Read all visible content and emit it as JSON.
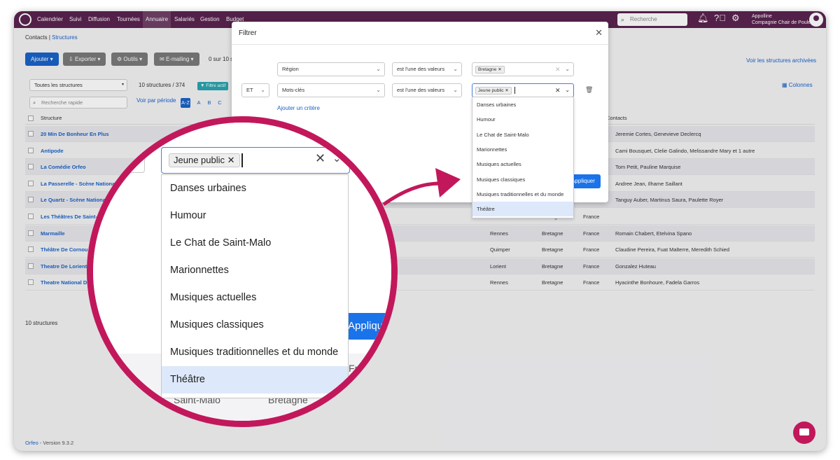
{
  "nav": {
    "items": [
      "Calendrier",
      "Suivi",
      "Diffusion",
      "Tournées",
      "Annuaire",
      "Salariés",
      "Gestion",
      "Budget"
    ],
    "active": "Annuaire",
    "search_placeholder": "Recherche",
    "user_name": "Appolline",
    "user_company": "Compagnie Chair de Poule"
  },
  "breadcrumb": {
    "root": "Contacts",
    "sep": "|",
    "current": "Structures"
  },
  "toolbar": {
    "add": "Ajouter",
    "export": "Exporter",
    "tools": "Outils",
    "emailing": "E-mailing",
    "selection_count": "0 sur 10 s",
    "archived_link": "Voir les structures archivées"
  },
  "filters": {
    "scope_select": "Toutes les structures",
    "count": "10 structures / 374",
    "active_badge": "Filtre actif",
    "quick_search_placeholder": "Recherche rapide",
    "by_period": "Voir par période",
    "alpha": [
      "A-Z",
      "A",
      "B",
      "C"
    ],
    "columns_link": "Colonnes"
  },
  "table": {
    "header_structure": "Structure",
    "rows": [
      {
        "name": "20 Min De Bonheur En Plus",
        "city": "",
        "region": "",
        "country": "",
        "contacts": "Jeremie Cortes, Genevieve Declercq"
      },
      {
        "name": "Antipode",
        "city": "",
        "region": "",
        "country": "",
        "contacts": "Cami Bousquet, Clelie Galindo, Melissandre Mary et 1 autre"
      },
      {
        "name": "La Comédie Orfeo",
        "city": "",
        "region": "",
        "country": "",
        "contacts": "Tom Petit, Pauline Marquise"
      },
      {
        "name": "La Passerelle - Scène Nationale",
        "city": "",
        "region": "",
        "country": "",
        "contacts": "Andree Jean, Ilhame Saillant"
      },
      {
        "name": "Le Quartz - Scène National",
        "city": "",
        "region": "",
        "country": "France",
        "contacts": "Tanguy Auber, Martinus Saura, Paulette Royer"
      },
      {
        "name": "Les Théâtres De Saint-M",
        "city": "Saint-Malo",
        "region": "Bretagne",
        "country": "France",
        "contacts": ""
      },
      {
        "name": "Marmaille",
        "city": "Rennes",
        "region": "Bretagne",
        "country": "France",
        "contacts": "Romain Chabert, Etelvina Spano"
      },
      {
        "name": "Théâtre De Cornou",
        "city": "Quimper",
        "region": "Bretagne",
        "country": "France",
        "contacts": "Claudine Pereira, Fuat Malterre, Meredith Schied"
      },
      {
        "name": "Theatre De Lorient",
        "city": "Lorient",
        "region": "Bretagne",
        "country": "France",
        "contacts": "Gonzalez Huteau"
      },
      {
        "name": "Theatre National De",
        "city": "Rennes",
        "region": "Bretagne",
        "country": "France",
        "contacts": "Hyacinthe Bonhoure, Fadela Garros"
      }
    ],
    "footer_count": "10 structures"
  },
  "version": {
    "brand": "Orfeo",
    "text": " - Version 9.3.2"
  },
  "modal": {
    "title": "Filtrer",
    "row1": {
      "field": "Région",
      "operator": "est l'une des valeurs",
      "value_chip": "Bretagne"
    },
    "row2": {
      "connector": "ET",
      "field": "Mots-clés",
      "operator": "est l'une des valeurs",
      "value_chip": "Jeune public"
    },
    "add_criterion": "Ajouter un critère",
    "apply": "Appliquer"
  },
  "dropdown": {
    "options": [
      "Danses urbaines",
      "Humour",
      "Le Chat de Saint-Malo",
      "Marionnettes",
      "Musiques actuelles",
      "Musiques classiques",
      "Musiques traditionnelles et du monde",
      "Théâtre"
    ],
    "highlighted": "Théâtre"
  },
  "magnifier": {
    "chip": "Jeune public",
    "apply_partial": "Appliqu",
    "bg_city": "Saint-Malo",
    "bg_region": "Bretagne",
    "bg_country_partial": "Fra"
  },
  "colors": {
    "nav": "#5b2350",
    "primary": "#1a63c8",
    "accent": "#c2185b",
    "highlight": "#dde8fa"
  }
}
